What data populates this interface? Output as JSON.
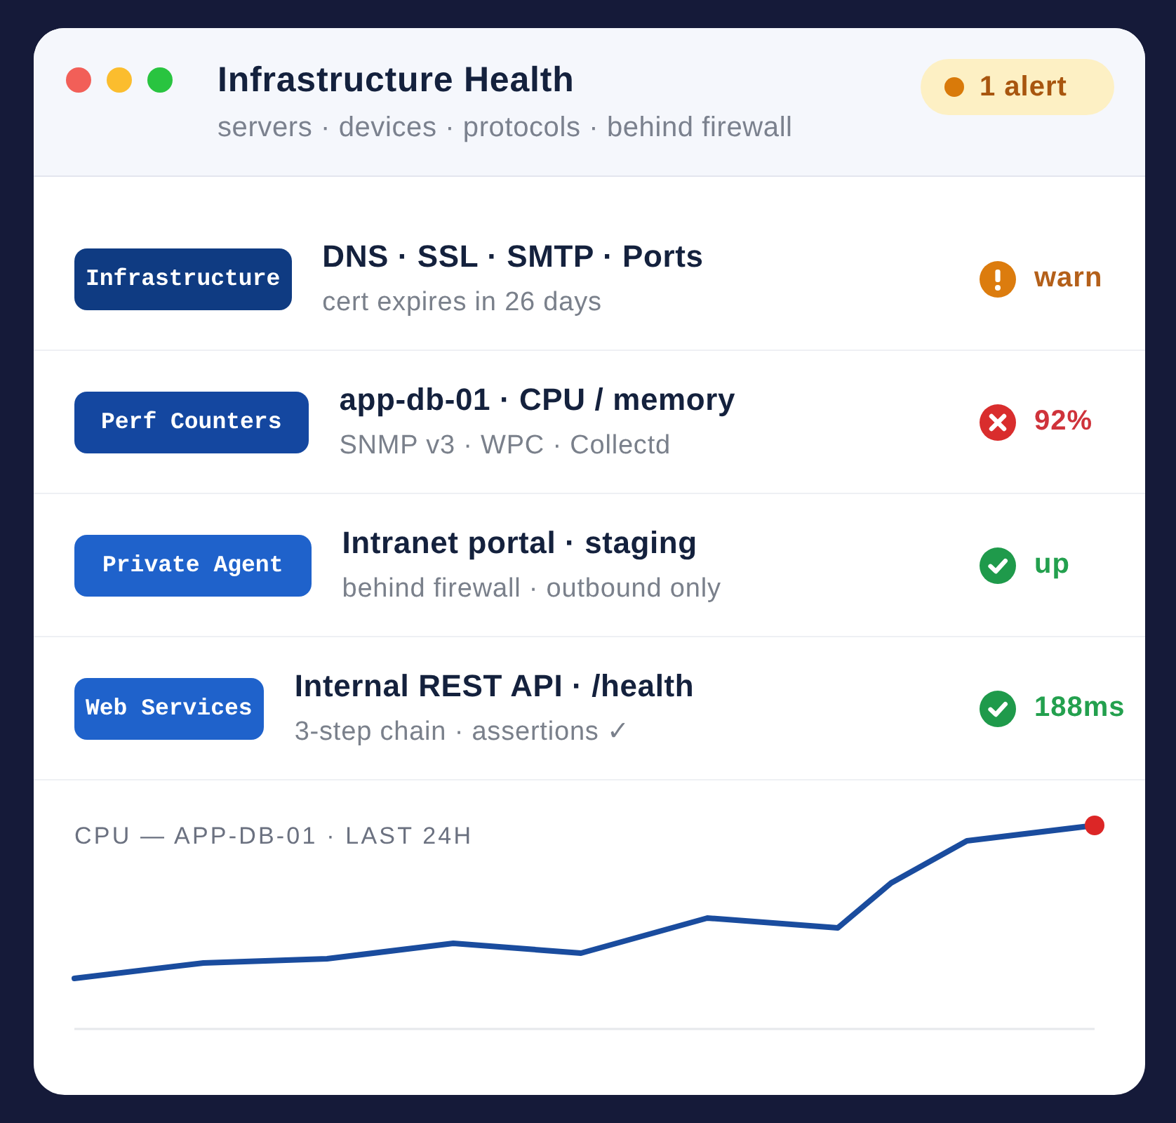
{
  "window": {
    "title": "Infrastructure Health",
    "subtitle": "servers · devices · protocols · behind firewall"
  },
  "alert_badge": {
    "label": "1 alert"
  },
  "checks": [
    {
      "tag": {
        "label": "Infrastructure",
        "color": "#0f3b82"
      },
      "title": "DNS · SSL · SMTP · Ports",
      "detail": "cert expires in 26 days",
      "status": {
        "kind": "warn",
        "label": "warn"
      }
    },
    {
      "tag": {
        "label": "Perf Counters",
        "color": "#1447a0"
      },
      "title": "app-db-01 · CPU / memory",
      "detail": "SNMP v3 · WPC · Collectd",
      "status": {
        "kind": "error",
        "label": "92%"
      }
    },
    {
      "tag": {
        "label": "Private Agent",
        "color": "#1f62cb"
      },
      "title": "Intranet portal · staging",
      "detail": "behind firewall · outbound only",
      "status": {
        "kind": "ok",
        "label": "up"
      }
    },
    {
      "tag": {
        "label": "Web Services",
        "color": "#1f62cb"
      },
      "title": "Internal REST API · /health",
      "detail": "3-step chain · assertions ✓",
      "status": {
        "kind": "ok",
        "label": "188ms"
      }
    }
  ],
  "chart": {
    "title": "CPU — APP-DB-01 · LAST 24H"
  }
}
